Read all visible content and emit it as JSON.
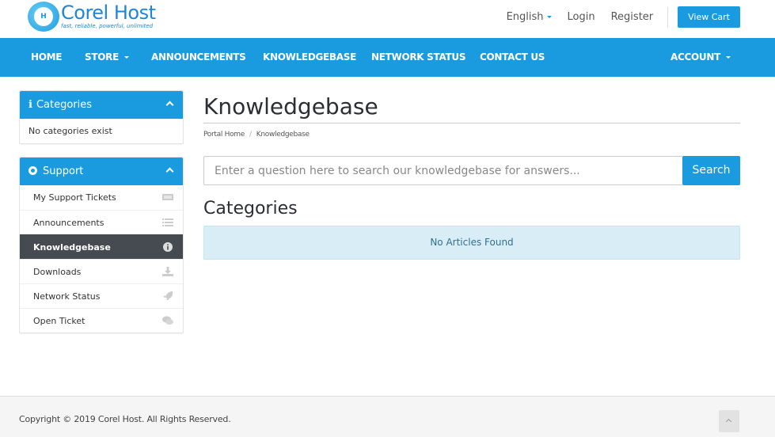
{
  "brand": {
    "name": "Corel Host",
    "tagline": "fast, reliable, powerful, unlimited",
    "monogram": "H",
    "color": "#1a9be0"
  },
  "top_links": {
    "language": "English",
    "login": "Login",
    "register": "Register",
    "view_cart": "View Cart"
  },
  "nav": {
    "items": [
      {
        "label": "HOME"
      },
      {
        "label": "STORE"
      },
      {
        "label": "ANNOUNCEMENTS"
      },
      {
        "label": "KNOWLEDGEBASE"
      },
      {
        "label": "NETWORK STATUS"
      },
      {
        "label": "CONTACT US"
      }
    ],
    "account": "ACCOUNT"
  },
  "sidebar": {
    "categories_panel": {
      "title": "Categories",
      "icon": "info-icon",
      "empty_text": "No categories exist"
    },
    "support_panel": {
      "title": "Support",
      "icon": "life-ring-icon",
      "items": [
        {
          "label": "My Support Tickets",
          "icon": "ticket-icon"
        },
        {
          "label": "Announcements",
          "icon": "list-icon"
        },
        {
          "label": "Knowledgebase",
          "icon": "info-circle-icon",
          "active": true
        },
        {
          "label": "Downloads",
          "icon": "download-icon"
        },
        {
          "label": "Network Status",
          "icon": "rocket-icon"
        },
        {
          "label": "Open Ticket",
          "icon": "comments-icon"
        }
      ]
    }
  },
  "main": {
    "title": "Knowledgebase",
    "breadcrumb": [
      {
        "label": "Portal Home"
      },
      {
        "label": "Knowledgebase"
      }
    ],
    "breadcrumb_sep": "/",
    "search": {
      "placeholder": "Enter a question here to search our knowledgebase for answers...",
      "value": "",
      "button": "Search"
    },
    "categories_title": "Categories",
    "empty_alert": "No Articles Found"
  },
  "footer": {
    "copyright": "Copyright © 2019 Corel Host. All Rights Reserved."
  }
}
